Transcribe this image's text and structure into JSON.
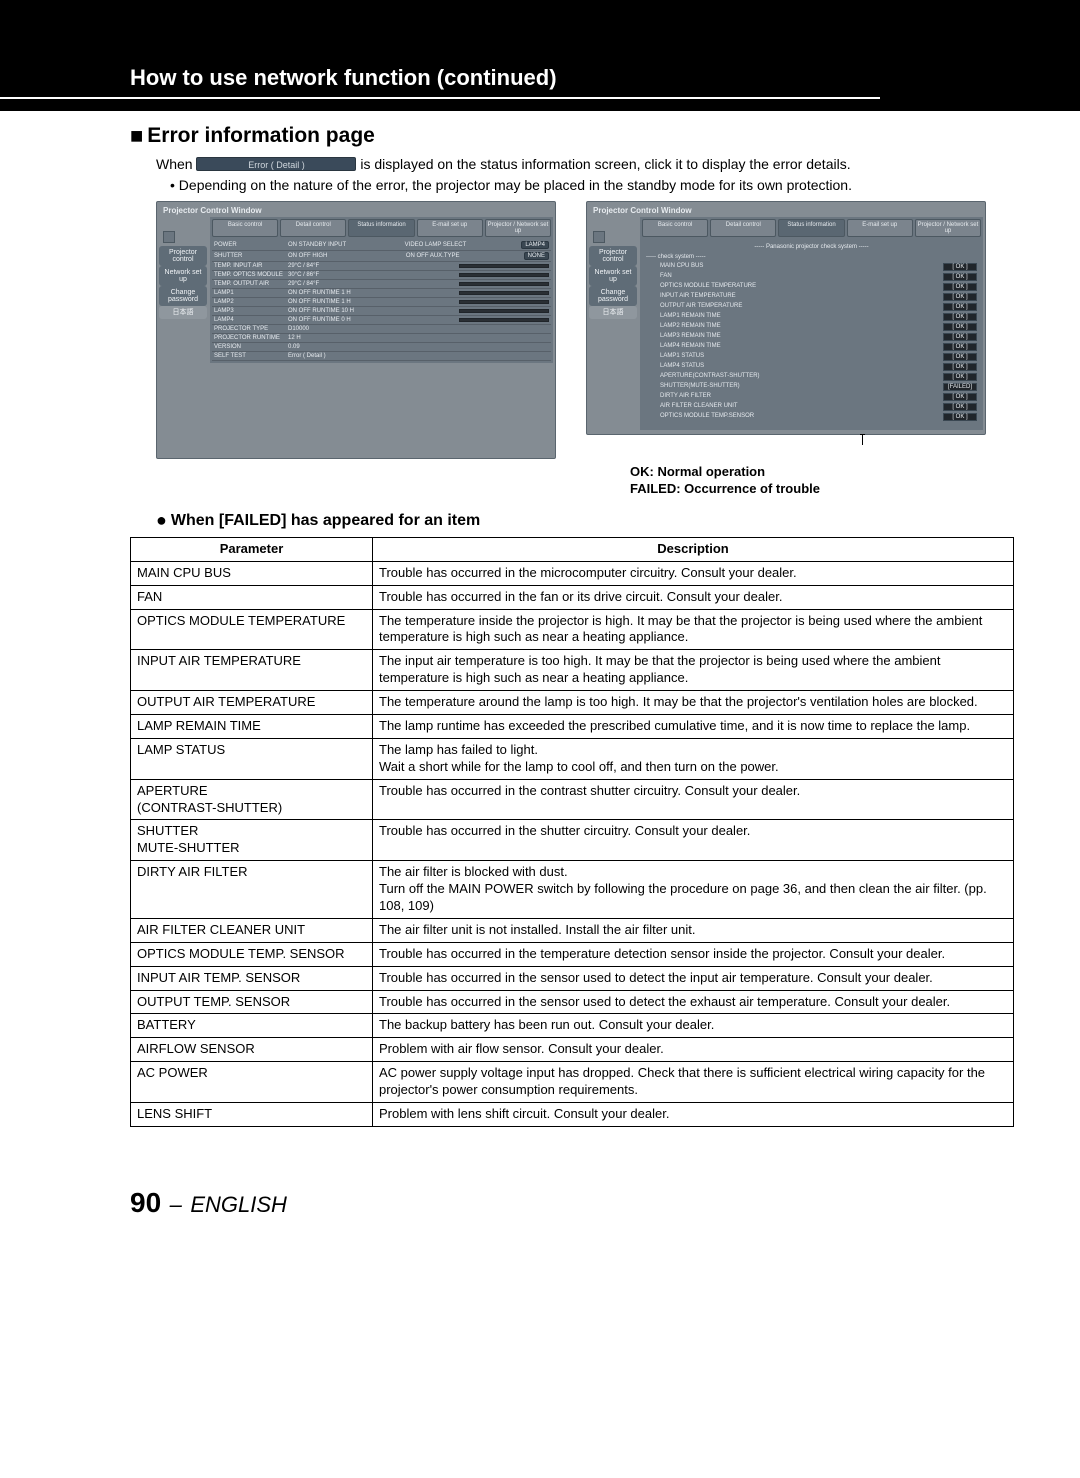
{
  "header": {
    "title": "How to use network function (continued)"
  },
  "section": {
    "title": "Error information page",
    "intro_prefix": "When",
    "error_button_label": "Error ( Detail )",
    "intro_suffix": "is displayed on the status information screen, click it to display the error details.",
    "bullet": "Depending on the nature of the error, the projector may be placed in the standby mode for its own protection."
  },
  "screenshot_left": {
    "window_title": "Projector Control Window",
    "side": [
      "Projector control",
      "Network set up",
      "Change password",
      "日本語"
    ],
    "tabs": [
      "Basic control",
      "Detail control",
      "Status information",
      "E-mail set up",
      "Projector / Network set up"
    ],
    "rows": [
      {
        "lbl": "POWER",
        "val": "ON   STANDBY   INPUT",
        "extra": "VIDEO   LAMP SELECT",
        "tag": "LAMP4"
      },
      {
        "lbl": "SHUTTER",
        "val": "ON   OFF   HIGH",
        "extra": "ON   OFF   AUX.TYPE",
        "tag": "NONE"
      },
      {
        "lbl": "TEMP. INPUT AIR",
        "val": "29°C / 84°F",
        "bar": true
      },
      {
        "lbl": "TEMP. OPTICS MODULE",
        "val": "30°C / 86°F",
        "bar": true
      },
      {
        "lbl": "TEMP. OUTPUT AIR",
        "val": "29°C / 84°F",
        "bar": true
      },
      {
        "lbl": "LAMP1",
        "val": "ON  OFF   RUNTIME     1 H",
        "bar": true
      },
      {
        "lbl": "LAMP2",
        "val": "ON  OFF   RUNTIME     1 H",
        "bar": true
      },
      {
        "lbl": "LAMP3",
        "val": "ON  OFF   RUNTIME    10 H",
        "bar": true
      },
      {
        "lbl": "LAMP4",
        "val": "ON  OFF   RUNTIME     0 H",
        "bar": true
      },
      {
        "lbl": "PROJECTOR TYPE",
        "val": "D10000"
      },
      {
        "lbl": "PROJECTOR RUNTIME",
        "val": "12 H"
      },
      {
        "lbl": "VERSION",
        "val": "0.09"
      },
      {
        "lbl": "SELF TEST",
        "val": "Error ( Detail )"
      }
    ]
  },
  "screenshot_right": {
    "window_title": "Projector Control Window",
    "side": [
      "Projector control",
      "Network set up",
      "Change password",
      "日本語"
    ],
    "tabs": [
      "Basic control",
      "Detail control",
      "Status information",
      "E-mail set up",
      "Projector / Network set up"
    ],
    "check_header": "----- Panasonic projector check system -----",
    "check_sub": "----- check system -----",
    "items": [
      {
        "name": "MAIN CPU BUS",
        "status": "[ OK ]"
      },
      {
        "name": "FAN",
        "status": "[ OK ]"
      },
      {
        "name": "OPTICS MODULE TEMPERATURE",
        "status": "[ OK ]"
      },
      {
        "name": "INPUT AIR TEMPERATURE",
        "status": "[ OK ]"
      },
      {
        "name": "OUTPUT AIR TEMPERATURE",
        "status": "[ OK ]"
      },
      {
        "name": "LAMP1 REMAIN TIME",
        "status": "[ OK ]"
      },
      {
        "name": "LAMP2 REMAIN TIME",
        "status": "[ OK ]"
      },
      {
        "name": "LAMP3 REMAIN TIME",
        "status": "[ OK ]"
      },
      {
        "name": "LAMP4 REMAIN TIME",
        "status": "[ OK ]"
      },
      {
        "name": "LAMP1 STATUS",
        "status": "[ OK ]"
      },
      {
        "name": "LAMP4 STATUS",
        "status": "[ OK ]"
      },
      {
        "name": "APERTURE(CONTRAST-SHUTTER)",
        "status": "[ OK ]"
      },
      {
        "name": "SHUTTER(MUTE-SHUTTER)",
        "status": "[FAILED]"
      },
      {
        "name": "DIRTY AIR FILTER",
        "status": "[ OK ]"
      },
      {
        "name": "AIR FILTER CLEANER UNIT",
        "status": "[ OK ]"
      },
      {
        "name": "OPTICS MODULE TEMP.SENSOR",
        "status": "[ OK ]"
      }
    ]
  },
  "legend": {
    "ok": "OK: Normal operation",
    "failed": "FAILED: Occurrence of trouble"
  },
  "subheading": "When [FAILED] has appeared for an item",
  "table": {
    "col_parameter": "Parameter",
    "col_description": "Description",
    "rows": [
      {
        "p": "MAIN CPU BUS",
        "d": "Trouble has occurred in the microcomputer circuitry. Consult your dealer."
      },
      {
        "p": "FAN",
        "d": "Trouble has occurred in the fan or its drive circuit. Consult your dealer."
      },
      {
        "p": "OPTICS MODULE TEMPERATURE",
        "d": "The temperature inside the projector is high. It may be that the projector is being used where the ambient temperature is high such as near a heating appliance."
      },
      {
        "p": "INPUT AIR TEMPERATURE",
        "d": "The input air temperature is too high. It may be that the projector is being used where the ambient temperature is high such as near a heating appliance."
      },
      {
        "p": "OUTPUT AIR TEMPERATURE",
        "d": "The temperature around the lamp is too high. It may be that the projector's ventilation holes are blocked."
      },
      {
        "p": "LAMP REMAIN TIME",
        "d": "The lamp runtime has exceeded the prescribed cumulative time, and it is now time to replace the lamp."
      },
      {
        "p": "LAMP STATUS",
        "d": "The lamp has failed to light.\nWait a short while for the lamp to cool off, and then turn on the power."
      },
      {
        "p": "APERTURE\n(CONTRAST-SHUTTER)",
        "d": "Trouble has occurred in the contrast shutter circuitry. Consult your dealer."
      },
      {
        "p": "SHUTTER\nMUTE-SHUTTER",
        "d": "Trouble has occurred in the shutter circuitry. Consult your dealer."
      },
      {
        "p": "DIRTY AIR FILTER",
        "d": "The air filter is blocked with dust.\nTurn off the MAIN POWER switch by following the procedure on page 36, and then clean the air filter. (pp. 108, 109)"
      },
      {
        "p": "AIR FILTER CLEANER UNIT",
        "d": "The air filter unit is not installed. Install the air filter unit."
      },
      {
        "p": "OPTICS MODULE TEMP. SENSOR",
        "d": "Trouble has occurred in the temperature detection sensor inside the projector. Consult your dealer."
      },
      {
        "p": "INPUT AIR TEMP. SENSOR",
        "d": "Trouble has occurred in the sensor used to detect the input air temperature. Consult your dealer."
      },
      {
        "p": "OUTPUT TEMP. SENSOR",
        "d": "Trouble has occurred in the sensor used to detect the exhaust air temperature. Consult your dealer."
      },
      {
        "p": "BATTERY",
        "d": "The backup battery has been run out. Consult your dealer."
      },
      {
        "p": "AIRFLOW SENSOR",
        "d": "Problem with air flow sensor. Consult your dealer."
      },
      {
        "p": "AC POWER",
        "d": "AC power supply voltage input has dropped. Check that there is sufficient electrical wiring capacity for the projector's power consumption requirements."
      },
      {
        "p": "LENS SHIFT",
        "d": "Problem with lens shift circuit. Consult your dealer."
      }
    ]
  },
  "footer": {
    "page_number": "90",
    "separator": "–",
    "language": "ENGLISH"
  }
}
